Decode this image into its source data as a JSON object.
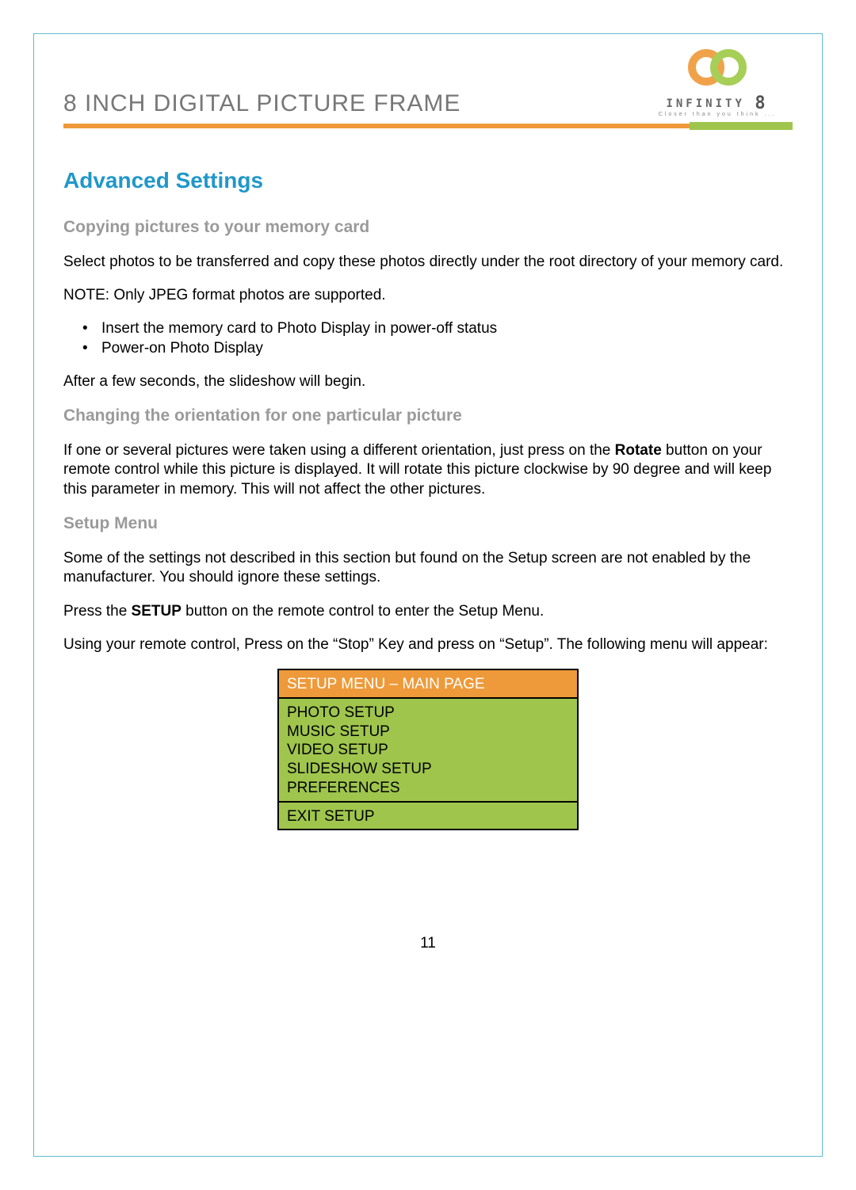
{
  "doc": {
    "title": "8 INCH DIGITAL PICTURE FRAME",
    "logo_brand": "INFINITY",
    "logo_brand_suffix": "8",
    "logo_tagline": "Closer than you think ..."
  },
  "section": {
    "title": "Advanced Settings"
  },
  "copy": {
    "heading": "Copying pictures to your memory card",
    "p1": "Select photos to be transferred and copy these photos directly under the root directory of your memory card.",
    "note": "NOTE: Only JPEG format photos are supported.",
    "bullets": [
      "Insert the memory card to Photo Display in power-off status",
      "Power-on Photo Display"
    ],
    "p2": "After a few seconds, the slideshow will begin."
  },
  "orient": {
    "heading": "Changing the orientation for one particular picture",
    "p_pre": "If one or several pictures were taken using a different orientation, just press on the ",
    "p_bold": "Rotate",
    "p_post": " button on your remote control while this picture is displayed. It will rotate this picture clockwise by 90 degree and will keep this parameter in memory. This will not affect the other pictures."
  },
  "setup": {
    "heading": "Setup Menu",
    "p1": "Some of the settings not described in this section but found on the Setup screen are not enabled by the manufacturer. You should ignore these settings.",
    "p2_pre": "Press the ",
    "p2_bold": "SETUP",
    "p2_post": " button on the remote control to enter the Setup Menu.",
    "p3": "Using your remote control, Press on the “Stop” Key and press on “Setup”. The following menu will appear:"
  },
  "menu": {
    "header": "SETUP MENU – MAIN PAGE",
    "items": [
      "PHOTO SETUP",
      "MUSIC SETUP",
      "VIDEO SETUP",
      "SLIDESHOW SETUP",
      "PREFERENCES"
    ],
    "exit": "EXIT SETUP"
  },
  "page_number": "11"
}
